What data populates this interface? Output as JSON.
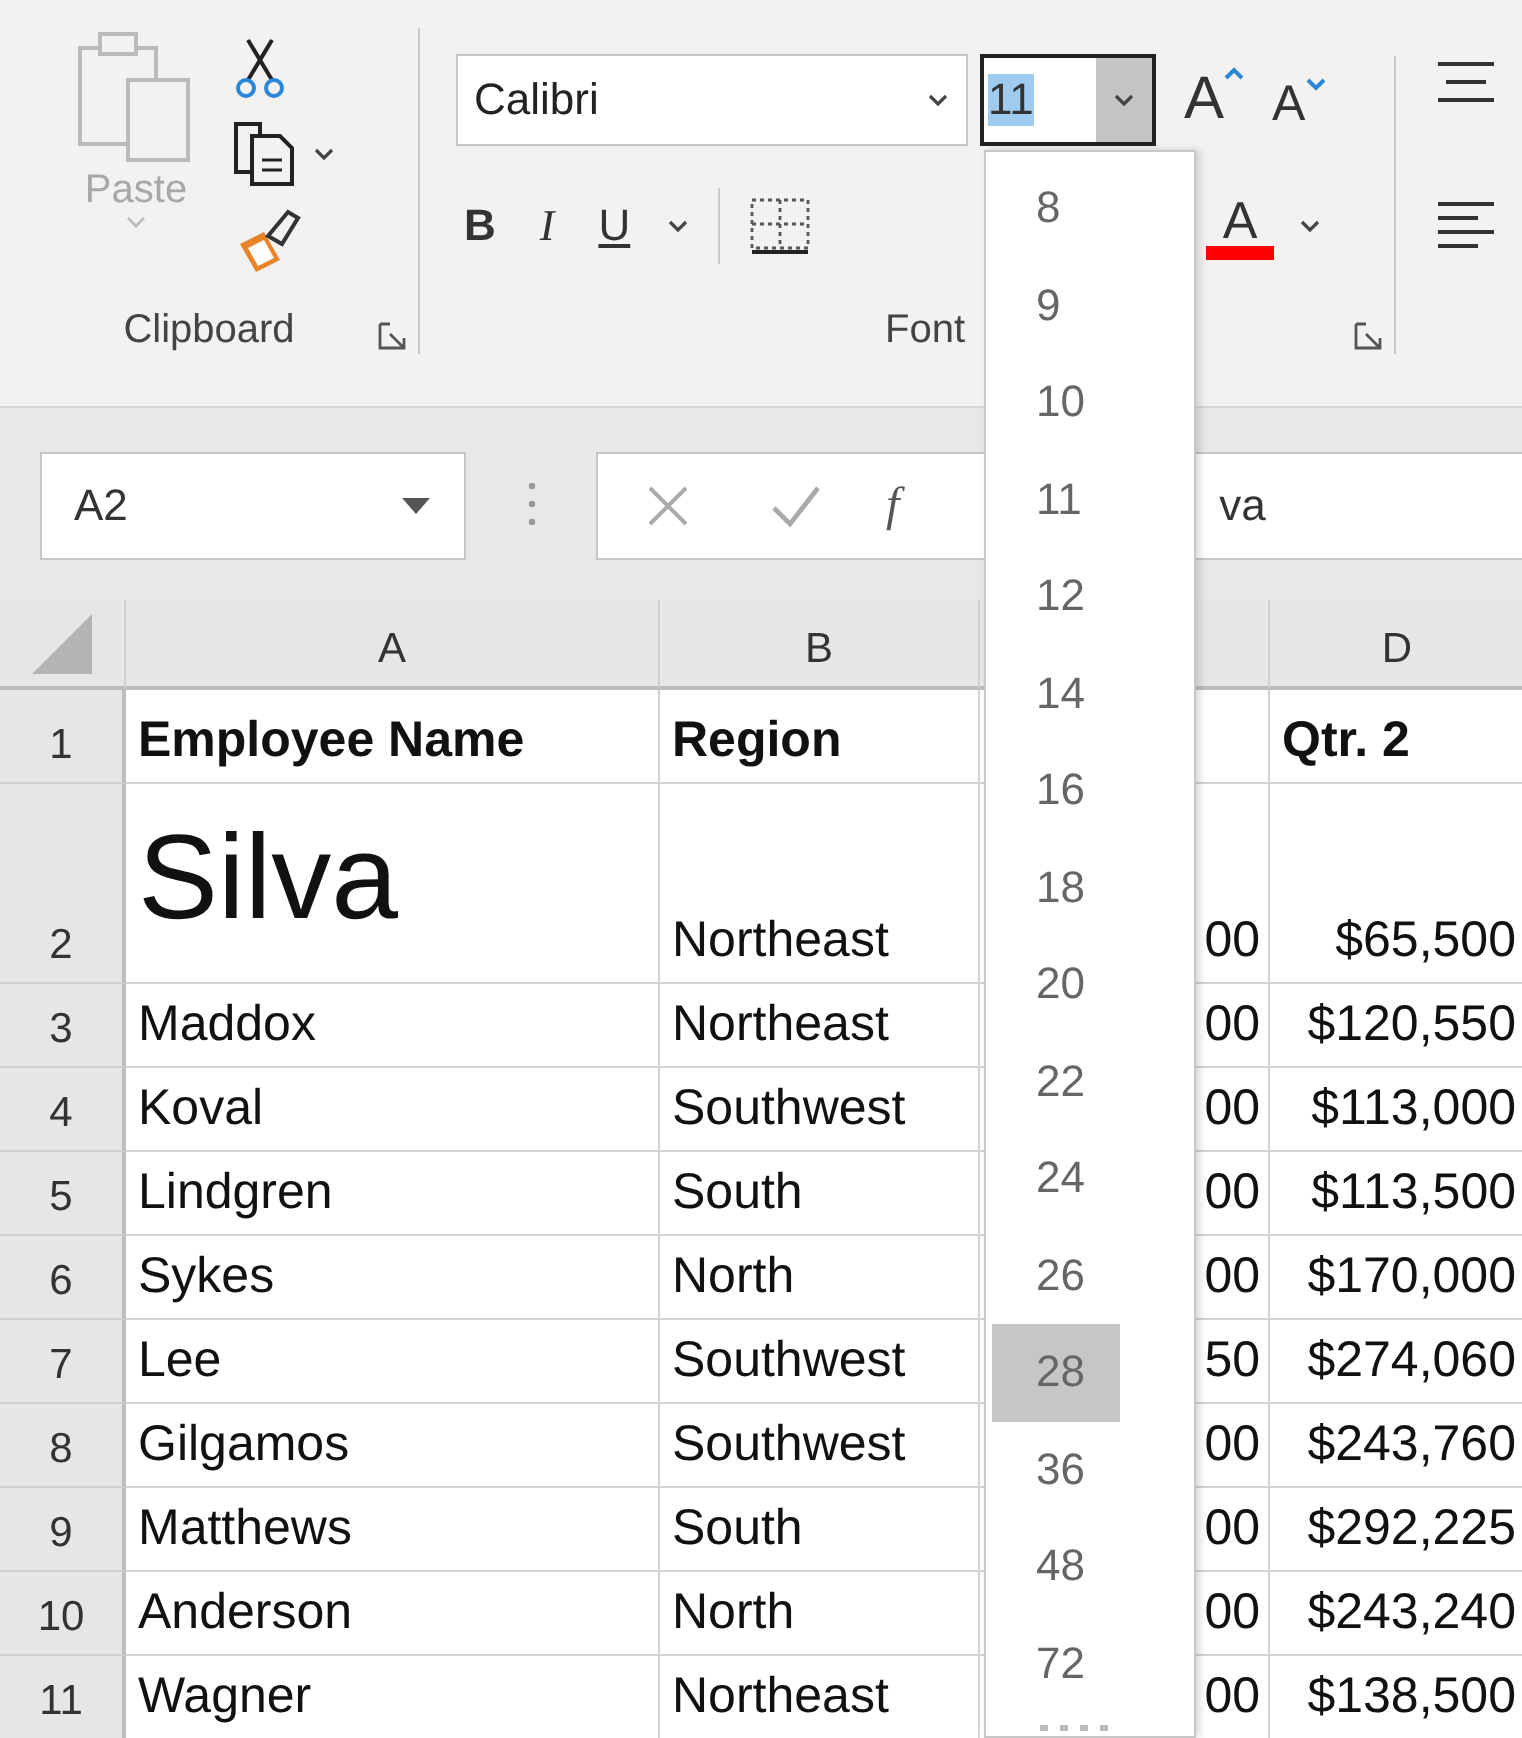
{
  "ribbon": {
    "clipboard": {
      "paste_label": "Paste",
      "group_label": "Clipboard"
    },
    "font": {
      "font_name": "Calibri",
      "font_size": "11",
      "grow_label": "A",
      "shrink_label": "A",
      "format_buttons": [
        {
          "kind": "bold",
          "label": "B"
        },
        {
          "kind": "italic",
          "label": "I"
        },
        {
          "kind": "underline",
          "label": "U"
        }
      ],
      "font_color_label": "A",
      "group_label": "Font"
    }
  },
  "formula_bar": {
    "name_box": "A2",
    "function_label": "f",
    "value": "va"
  },
  "sheet": {
    "columns": [
      "A",
      "B",
      "",
      "D"
    ],
    "rows": [
      {
        "number": "1",
        "kind": "header",
        "cells": [
          "Employee Name",
          "Region",
          "",
          "Qtr. 2"
        ]
      },
      {
        "number": "2",
        "kind": "large",
        "cells": [
          "Silva",
          "Northeast",
          "00",
          "$65,500"
        ]
      },
      {
        "number": "3",
        "kind": "normal",
        "cells": [
          "Maddox",
          "Northeast",
          "00",
          "$120,550"
        ]
      },
      {
        "number": "4",
        "kind": "normal",
        "cells": [
          "Koval",
          "Southwest",
          "00",
          "$113,000"
        ]
      },
      {
        "number": "5",
        "kind": "normal",
        "cells": [
          "Lindgren",
          "South",
          "00",
          "$113,500"
        ]
      },
      {
        "number": "6",
        "kind": "normal",
        "cells": [
          "Sykes",
          "North",
          "00",
          "$170,000"
        ]
      },
      {
        "number": "7",
        "kind": "normal",
        "cells": [
          "Lee",
          "Southwest",
          "50",
          "$274,060"
        ]
      },
      {
        "number": "8",
        "kind": "normal",
        "cells": [
          "Gilgamos",
          "Southwest",
          "00",
          "$243,760"
        ]
      },
      {
        "number": "9",
        "kind": "normal",
        "cells": [
          "Matthews",
          "South",
          "00",
          "$292,225"
        ]
      },
      {
        "number": "10",
        "kind": "normal",
        "cells": [
          "Anderson",
          "North",
          "00",
          "$243,240"
        ]
      },
      {
        "number": "11",
        "kind": "normal",
        "cells": [
          "Wagner",
          "Northeast",
          "00",
          "$138,500"
        ]
      }
    ]
  },
  "size_dropdown": {
    "options": [
      {
        "label": "8",
        "selected": false
      },
      {
        "label": "9",
        "selected": false
      },
      {
        "label": "10",
        "selected": false
      },
      {
        "label": "11",
        "selected": false
      },
      {
        "label": "12",
        "selected": false
      },
      {
        "label": "14",
        "selected": false
      },
      {
        "label": "16",
        "selected": false
      },
      {
        "label": "18",
        "selected": false
      },
      {
        "label": "20",
        "selected": false
      },
      {
        "label": "22",
        "selected": false
      },
      {
        "label": "24",
        "selected": false
      },
      {
        "label": "26",
        "selected": false
      },
      {
        "label": "28",
        "selected": true
      },
      {
        "label": "36",
        "selected": false
      },
      {
        "label": "48",
        "selected": false
      },
      {
        "label": "72",
        "selected": false
      }
    ]
  }
}
